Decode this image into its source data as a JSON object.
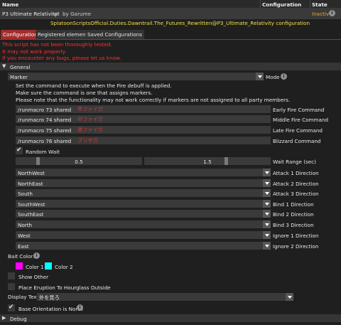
{
  "header": {
    "name_col": "Name",
    "config_col": "Configuration",
    "state_col": "State"
  },
  "plugin": {
    "name": "P3 Ultimate Relativity",
    "version": "v8",
    "author": "by Garume",
    "state": "Inactive"
  },
  "config_title": "SplatoonScriptsOfficial.Duties.Dawntrail.The_Futures_Rewritten@P3_Ultimate_Relativity configuration",
  "tabs": [
    "Configuration",
    "Registered elements",
    "Saved Configurations"
  ],
  "warnings": [
    "This script has not been thoroughly tested.",
    "It may not work properly.",
    "If you encounter any bugs, please let us know."
  ],
  "general": {
    "title": "General",
    "mode_value": "Marker",
    "mode_label": "Mode",
    "description": [
      "Set the command to execute when the Fire debuff is applied.",
      "Make sure the command is one that assigns markers.",
      "Please note that the functionality may not work correctly if markers are not assigned to all party members."
    ],
    "commands": [
      {
        "value": "/runmacro 73 shared",
        "jp": "早ファイガ",
        "label": "Early Fire Command"
      },
      {
        "value": "/runmacro 74 shared",
        "jp": "中ファイガ",
        "label": "Middle Fire Command"
      },
      {
        "value": "/runmacro 75 shared",
        "jp": "遅ファイガ",
        "label": "Late Fire Command"
      },
      {
        "value": "/runmacro 76 shared",
        "jp": "ブリザガ",
        "label": "Blizzard Command"
      }
    ],
    "random_wait_label": "Random Wait",
    "wait_range": {
      "min": "0.5",
      "max": "1.5",
      "label": "Wait Range (sec)"
    },
    "directions": [
      {
        "value": "NorthWest",
        "label": "Attack 1 Direction"
      },
      {
        "value": "NorthEast",
        "label": "Attack 2 Direction"
      },
      {
        "value": "South",
        "label": "Attack 3 Direction"
      },
      {
        "value": "SouthWest",
        "label": "Bind 1 Direction"
      },
      {
        "value": "SouthEast",
        "label": "Bind 2 Direction"
      },
      {
        "value": "North",
        "label": "Bind 3 Direction"
      },
      {
        "value": "West",
        "label": "Ignore 1 Direction"
      },
      {
        "value": "East",
        "label": "Ignore 2 Direction"
      }
    ],
    "bait_color_label": "Bait Color:",
    "color1_label": "Color 1",
    "color2_label": "Color 2",
    "color1": "#ff00ff",
    "color2": "#00ffff",
    "show_other_label": "Show Other",
    "place_eruption_label": "Place Eruption To Hourglass Outside",
    "display_text_label": "Display Text:",
    "display_text_value": "外を見ろ",
    "base_orientation_label": "Base Orientation is North"
  },
  "debug": {
    "title": "Debug"
  },
  "colors": {
    "accent": "#a32c2c",
    "title": "#f2e14d",
    "warning": "#ff3030",
    "state": "#e8a628"
  }
}
